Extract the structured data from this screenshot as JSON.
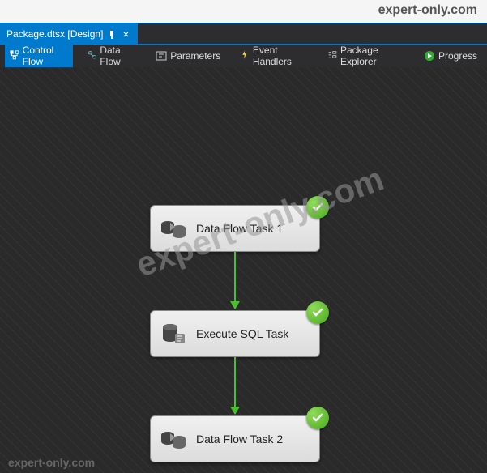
{
  "watermark": "expert-only.com",
  "document": {
    "tab_title": "Package.dtsx [Design]"
  },
  "toolbar": {
    "control_flow": "Control Flow",
    "data_flow": "Data Flow",
    "parameters": "Parameters",
    "event_handlers": "Event Handlers",
    "package_explorer": "Package Explorer",
    "progress": "Progress"
  },
  "tasks": [
    {
      "label": "Data Flow Task 1",
      "type": "dataflow",
      "status": "success"
    },
    {
      "label": "Execute SQL Task",
      "type": "sql",
      "status": "success"
    },
    {
      "label": "Data Flow Task 2",
      "type": "dataflow",
      "status": "success"
    }
  ]
}
